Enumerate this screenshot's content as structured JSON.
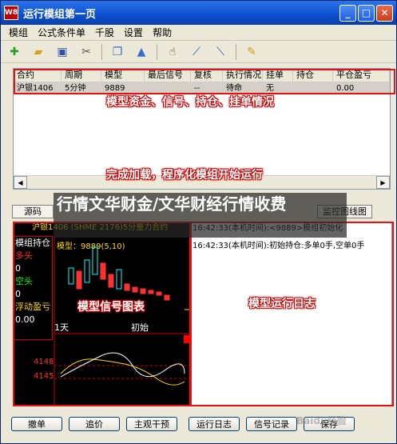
{
  "window": {
    "title": "运行模组第一页",
    "app_icon": "W8"
  },
  "menu": [
    "模组",
    "公式条件单",
    "千股",
    "设置",
    "帮助"
  ],
  "toolbar_icons": [
    "add-icon",
    "open-folder-icon",
    "save-icon",
    "cut-icon",
    "copy-icon",
    "bell-icon",
    "hand-icon",
    "signal-rise-icon",
    "signal-fall-icon",
    "note-icon"
  ],
  "grid": {
    "headers": [
      "合约",
      "周期",
      "模型",
      "最后信号",
      "复核",
      "执行情况",
      "挂单",
      "持仓",
      "平仓盈亏"
    ],
    "rows": [
      [
        "沪银1406",
        "5分钟",
        "9889",
        "",
        "--",
        "待命",
        "无",
        "",
        "0.00"
      ]
    ]
  },
  "annotations": {
    "grid": "模型资金、信号、持仓、挂单情况",
    "load": "完成加载，程序化模组开始运行",
    "chart": "模型信号图表",
    "log": "模型运行日志",
    "overlay": "行情文华财金/文华财经行情收费"
  },
  "tabs": [
    "源码",
    "监控图线图"
  ],
  "chart": {
    "title": "沪银1406 (SHME 2176)5分量力合约",
    "model_label": "模型：9889(5,10)",
    "day_label": "1天",
    "init_label": "初始",
    "price_levels": [
      "4148",
      "4145"
    ],
    "colors": {
      "up": "#00ffff",
      "down": "#ff3030",
      "ma": "#ffd800"
    }
  },
  "side_info": {
    "title": "模组持仓",
    "long": "多头",
    "long_val": "0",
    "short": "空头",
    "short_val": "0",
    "float_pnl": "浮动盈亏",
    "float_val": "0.00"
  },
  "log": [
    "16:42:33(本机时间):<9889>模组初始化",
    "16:42:33(本机时间):初始持仓:多单0手,空单0手"
  ],
  "bottom_buttons": [
    "撤单",
    "追价",
    "主观干预",
    "运行日志",
    "信号记录",
    "保存"
  ],
  "watermark": "Baidu经验"
}
